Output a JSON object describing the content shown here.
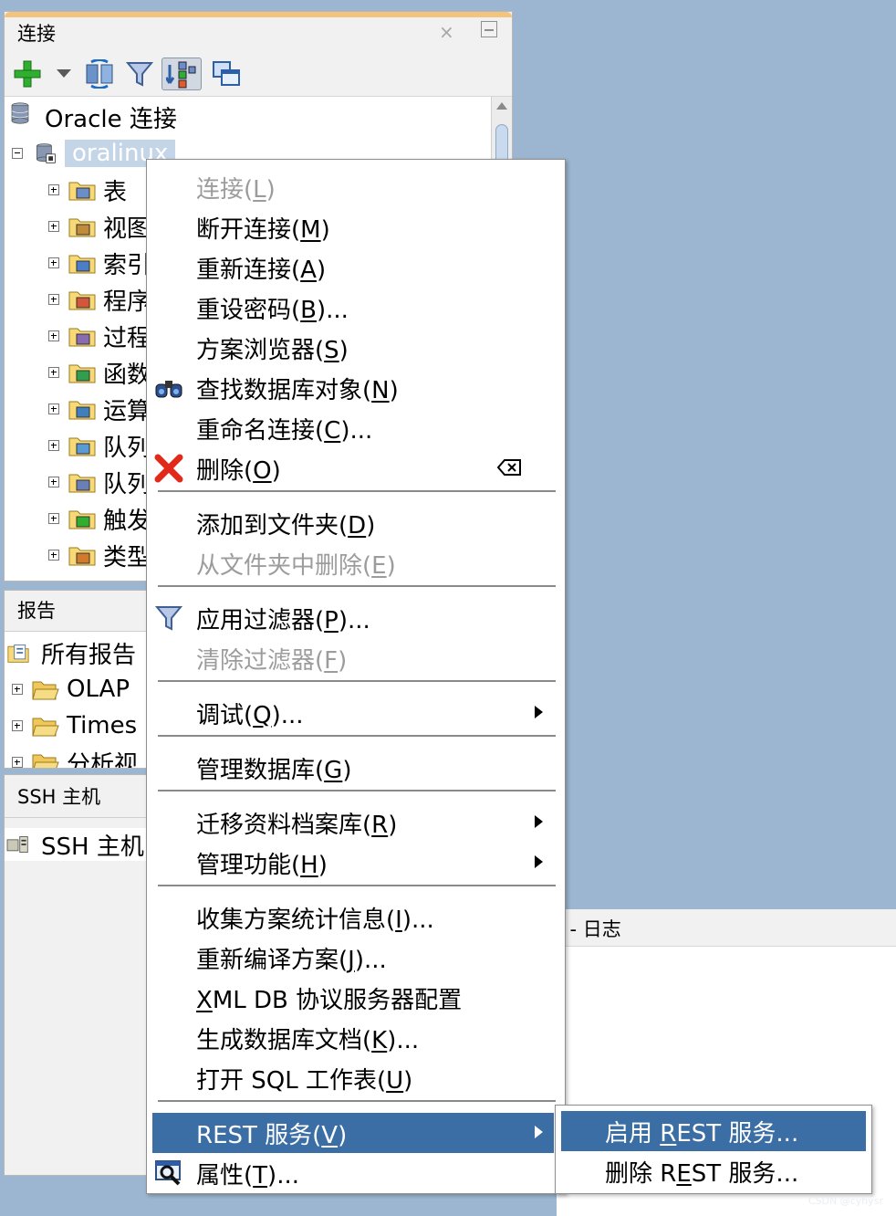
{
  "connections_panel": {
    "title": "连接",
    "close_glyph": "×",
    "toolbar": [
      {
        "icon": "add-plus-icon"
      },
      {
        "icon": "dropdown-arrow-icon"
      },
      {
        "icon": "refresh-icon"
      },
      {
        "icon": "filter-icon"
      },
      {
        "icon": "schema-browser-icon"
      },
      {
        "icon": "copy-window-icon"
      }
    ],
    "tree": {
      "root_label": "Oracle 连接",
      "connection_label": "oralinux",
      "children": [
        "表",
        "视图",
        "索引",
        "程序",
        "过程",
        "函数",
        "运算",
        "队列",
        "队列",
        "触发",
        "类型"
      ]
    }
  },
  "reports_panel": {
    "title": "报告",
    "root_label": "所有报告",
    "items": [
      "OLAP",
      "Times",
      "分析视"
    ]
  },
  "ssh_panel": {
    "title": "SSH 主机",
    "root_label": "SSH 主机"
  },
  "log_panel": {
    "title": "l - 日志"
  },
  "context_menu": {
    "items": [
      {
        "label": "连接(L)",
        "mn": "L",
        "pre": "连接(",
        "post": ")",
        "disabled": true
      },
      {
        "label": "断开连接(M)",
        "pre": "断开连接(",
        "mn": "M",
        "post": ")"
      },
      {
        "label": "重新连接(A)",
        "pre": "重新连接(",
        "mn": "A",
        "post": ")"
      },
      {
        "label": "重设密码(B)...",
        "pre": "重设密码(",
        "mn": "B",
        "post": ")..."
      },
      {
        "label": "方案浏览器(S)",
        "pre": "方案浏览器(",
        "mn": "S",
        "post": ")"
      },
      {
        "label": "查找数据库对象(N)",
        "pre": "查找数据库对象(",
        "mn": "N",
        "post": ")"
      },
      {
        "label": "重命名连接(C)...",
        "pre": "重命名连接(",
        "mn": "C",
        "post": ")..."
      },
      {
        "label": "删除(O)",
        "pre": "删除(",
        "mn": "O",
        "post": ")"
      },
      {
        "label": "添加到文件夹(D)",
        "pre": "添加到文件夹(",
        "mn": "D",
        "post": ")"
      },
      {
        "label": "从文件夹中删除(E)",
        "pre": "从文件夹中删除(",
        "mn": "E",
        "post": ")",
        "disabled": true
      },
      {
        "label": "应用过滤器(P)...",
        "pre": "应用过滤器(",
        "mn": "P",
        "post": ")..."
      },
      {
        "label": "清除过滤器(F)",
        "pre": "清除过滤器(",
        "mn": "F",
        "post": ")",
        "disabled": true
      },
      {
        "label": "调试(Q)...",
        "pre": "调试(",
        "mn": "Q",
        "post": ")..."
      },
      {
        "label": "管理数据库(G)",
        "pre": "管理数据库(",
        "mn": "G",
        "post": ")"
      },
      {
        "label": "迁移资料档案库(R)",
        "pre": "迁移资料档案库(",
        "mn": "R",
        "post": ")"
      },
      {
        "label": "管理功能(H)",
        "pre": "管理功能(",
        "mn": "H",
        "post": ")"
      },
      {
        "label": "收集方案统计信息(I)...",
        "pre": "收集方案统计信息(",
        "mn": "I",
        "post": ")..."
      },
      {
        "label": "重新编译方案(J)...",
        "pre": "重新编译方案(",
        "mn": "J",
        "post": ")..."
      },
      {
        "label": "XML DB 协议服务器配置",
        "pre": "",
        "mn": "X",
        "post": "ML DB 协议服务器配置"
      },
      {
        "label": "生成数据库文档(K)...",
        "pre": "生成数据库文档(",
        "mn": "K",
        "post": ")..."
      },
      {
        "label": "打开 SQL 工作表(U)",
        "pre": "打开 SQL 工作表(",
        "mn": "U",
        "post": ")"
      },
      {
        "label": "REST 服务(V)",
        "pre": "REST 服务(",
        "mn": "V",
        "post": ")",
        "active": true
      },
      {
        "label": "属性(T)...",
        "pre": "属性(",
        "mn": "T",
        "post": ")..."
      }
    ]
  },
  "rest_submenu": {
    "items": [
      {
        "label": "启用 REST 服务...",
        "pre": "启用 ",
        "mn": "R",
        "post": "EST 服务...",
        "active": true
      },
      {
        "label": "删除 REST 服务...",
        "pre": "删除 R",
        "mn": "E",
        "post": "ST 服务..."
      }
    ]
  },
  "watermark": "CSDN @cyhysr",
  "colors": {
    "desktop_bg": "#9cb6d1",
    "menu_highlight": "#3b6ea4",
    "disabled_text": "#9c9c9c",
    "panel_accent": "#f3c47e"
  }
}
